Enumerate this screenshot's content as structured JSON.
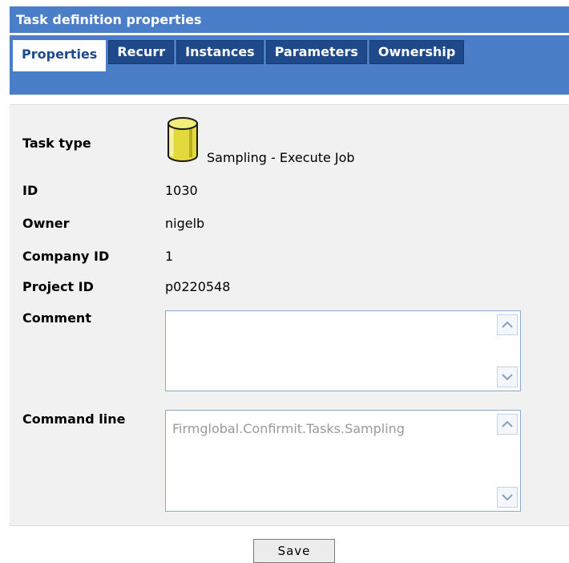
{
  "window": {
    "title": "Task definition properties"
  },
  "tabs": [
    {
      "label": "Properties",
      "active": true
    },
    {
      "label": "Recurr",
      "active": false
    },
    {
      "label": "Instances",
      "active": false
    },
    {
      "label": "Parameters",
      "active": false
    },
    {
      "label": "Ownership",
      "active": false
    }
  ],
  "properties": {
    "task_type": {
      "label": "Task type",
      "value": "Sampling - Execute Job",
      "icon": "database-cylinder-icon"
    },
    "id": {
      "label": "ID",
      "value": "1030"
    },
    "owner": {
      "label": "Owner",
      "value": "nigelb"
    },
    "company_id": {
      "label": "Company ID",
      "value": "1"
    },
    "project_id": {
      "label": "Project ID",
      "value": "p0220548"
    },
    "comment": {
      "label": "Comment",
      "value": ""
    },
    "command_line": {
      "label": "Command line",
      "value": "Firmglobal.Confirmit.Tasks.Sampling"
    }
  },
  "actions": {
    "save_label": "Save"
  },
  "colors": {
    "header_blue": "#4a7ec9",
    "tab_dark_blue": "#1e4a8c",
    "panel_gray": "#f1f1f1",
    "icon_yellow": "#e8e04a"
  }
}
